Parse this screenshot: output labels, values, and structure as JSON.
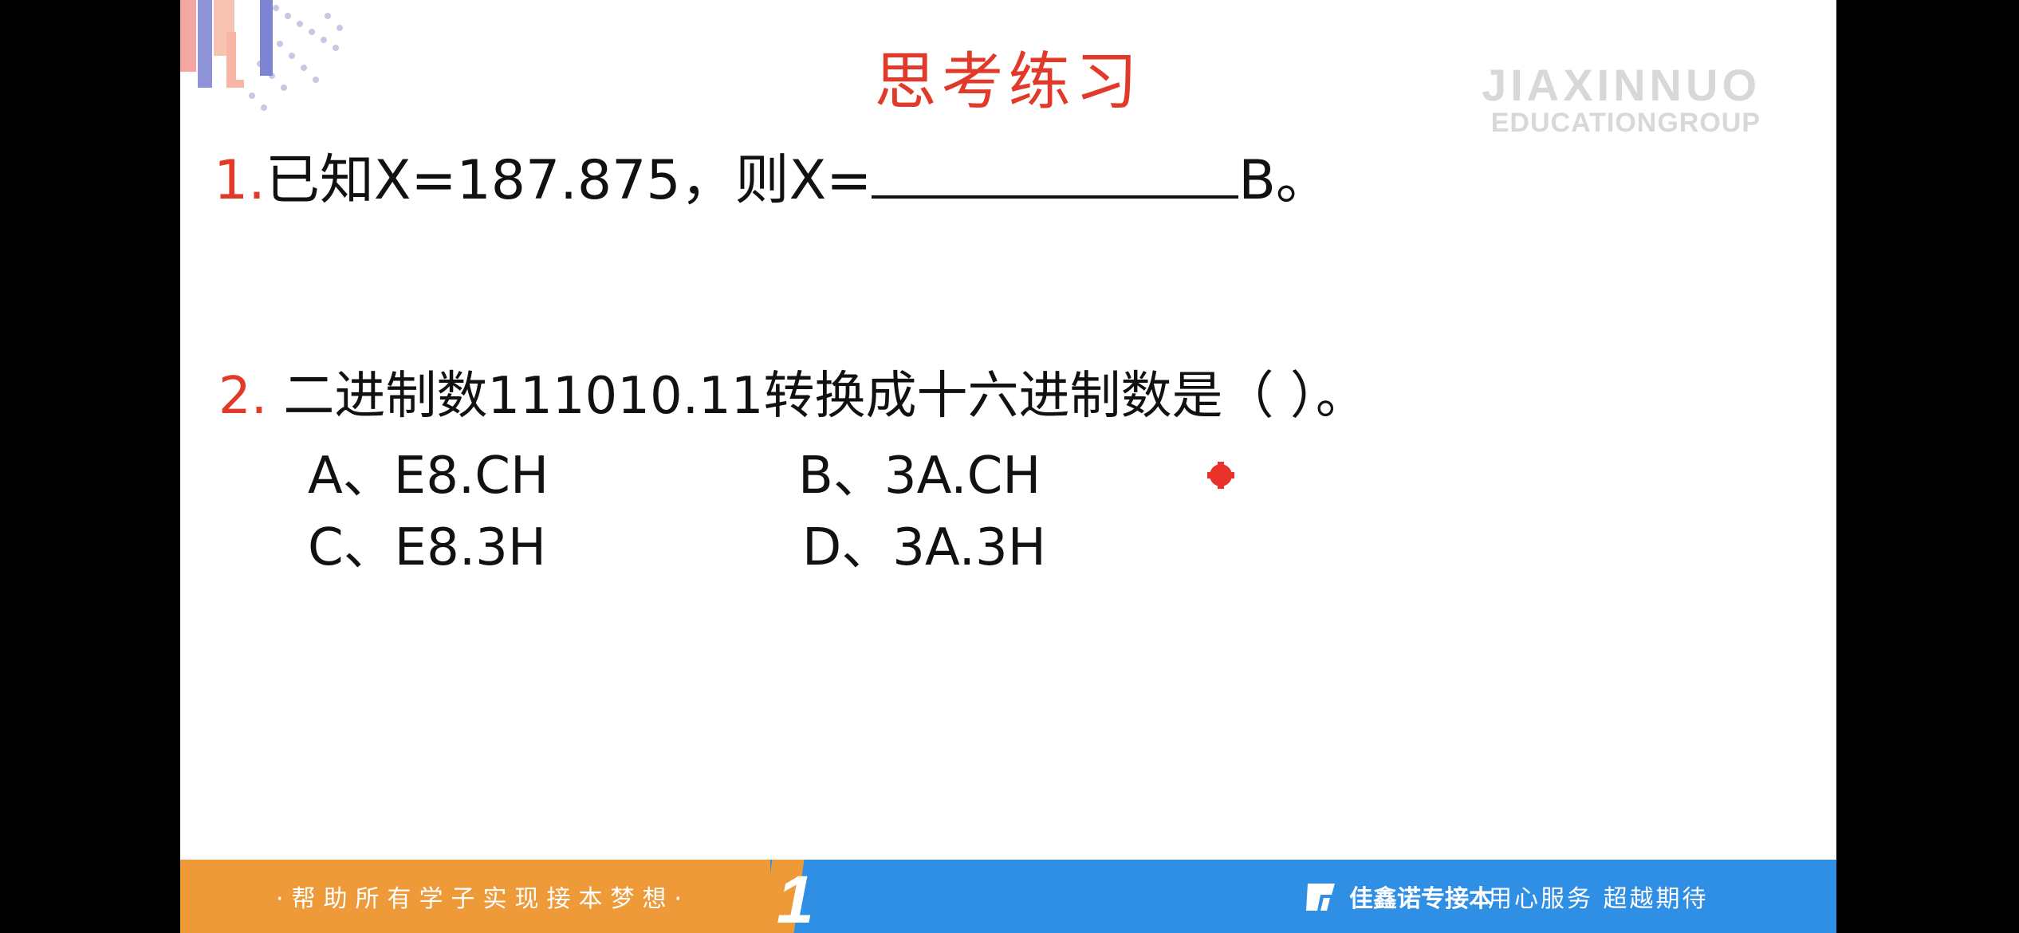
{
  "slide": {
    "title": "思考练习",
    "watermark": {
      "line1": "JIAXINNUO",
      "line2": "EDUCATIONGROUP"
    },
    "q1": {
      "num": "1.",
      "text_before": "已知X=187.875，则X=",
      "text_after": "B。"
    },
    "q2": {
      "num": "2.",
      "text": "二进制数111010.11转换成十六进制数是（  ）。",
      "options": {
        "a": "A、E8.CH",
        "b": "B、3A.CH",
        "c": "C、E8.3H",
        "d": "D、3A.3H"
      }
    }
  },
  "footer": {
    "slogan": "·帮助所有学子实现接本梦想·",
    "big_numeral": "1",
    "brand": "佳鑫诺专接本",
    "motto": "用心服务  超越期待"
  },
  "colors": {
    "accent": "#e23a2a",
    "orange": "#ee9a38",
    "blue": "#2f8fe4"
  }
}
